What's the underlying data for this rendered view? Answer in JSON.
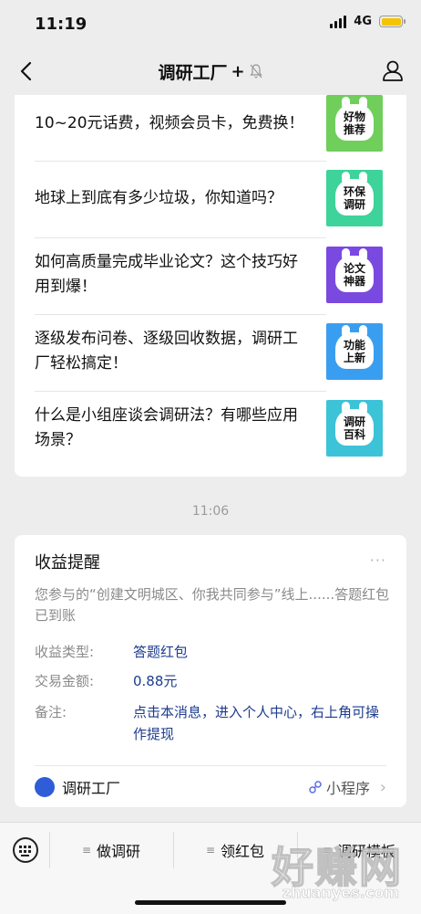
{
  "status_bar": {
    "time": "11:19",
    "network": "4G"
  },
  "nav": {
    "title": "调研工厂",
    "plus": "+"
  },
  "articles": [
    {
      "title": "10~20元话费，视频会员卡，免费换！",
      "thumb": "好物推荐",
      "color": "#6fcf5a"
    },
    {
      "title": "地球上到底有多少垃圾，你知道吗？",
      "thumb": "环保调研",
      "color": "#3dd39a"
    },
    {
      "title": "如何高质量完成毕业论文？这个技巧好用到爆！",
      "thumb": "论文神器",
      "color": "#7a49e0"
    },
    {
      "title": "逐级发布问卷、逐级回收数据，调研工厂轻松搞定！",
      "thumb": "功能上新",
      "color": "#3a9ef0"
    },
    {
      "title": "什么是小组座谈会调研法？有哪些应用场景？",
      "thumb": "调研百科",
      "color": "#3cc3d8"
    }
  ],
  "timestamp": "11:06",
  "notice": {
    "heading": "收益提醒",
    "more": "···",
    "description": "您参与的“创建文明城区、你我共同参与”线上......答题红包已到账",
    "rows": [
      {
        "key": "收益类型:",
        "value": "答题红包"
      },
      {
        "key": "交易金额:",
        "value": "0.88元"
      },
      {
        "key": "备注:",
        "value": "点击本消息，进入个人中心，右上角可操作提现"
      }
    ],
    "source": "调研工厂",
    "mini_program": "小程序"
  },
  "bottom_menu": {
    "item1": "做调研",
    "item2": "领红包",
    "item3": "调研模板"
  },
  "watermark": {
    "main": "好赚网",
    "sub": "zhuanyes.com"
  }
}
